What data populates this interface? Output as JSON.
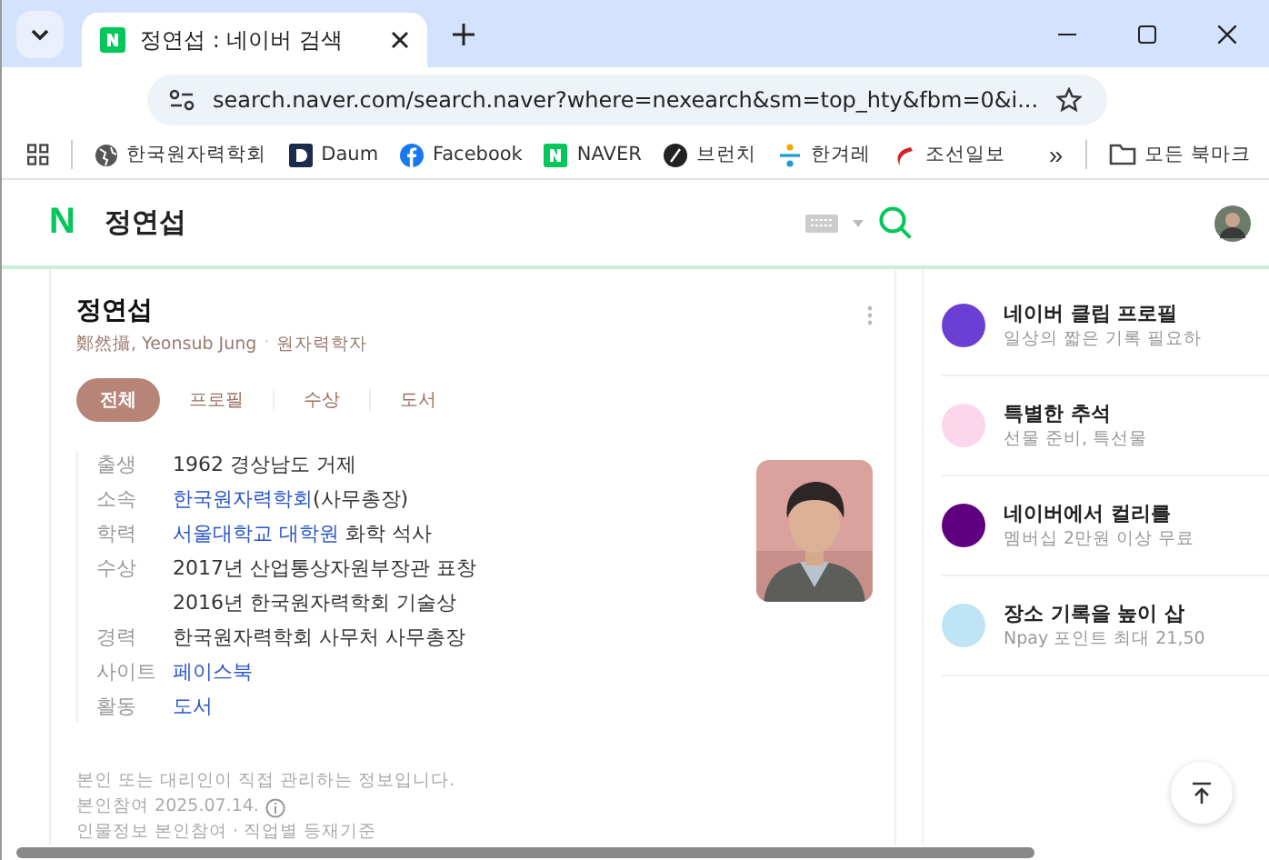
{
  "browser": {
    "tab": {
      "title": "정연섭 : 네이버 검색",
      "selected": true
    },
    "url": "search.naver.com/search.naver?where=nexearch&sm=top_hty&fbm=0&i...",
    "bookmarks": [
      {
        "label": "한국원자력학회",
        "kind": "globe"
      },
      {
        "label": "Daum",
        "kind": "daum"
      },
      {
        "label": "Facebook",
        "kind": "facebook"
      },
      {
        "label": "NAVER",
        "kind": "naver"
      },
      {
        "label": "브런치",
        "kind": "brunch"
      },
      {
        "label": "한겨레",
        "kind": "hani"
      },
      {
        "label": "조선일보",
        "kind": "chosun"
      }
    ],
    "overflow": "»",
    "all_bookmarks": "모든 북마크"
  },
  "header": {
    "logo": "N",
    "query": "정연섭"
  },
  "profile": {
    "name": "정연섭",
    "subtitle": "鄭然攝, Yeonsub Jung",
    "separator": "·",
    "job": "원자력학자",
    "tabs": [
      {
        "label": "전체",
        "selected": true
      },
      {
        "label": "프로필",
        "selected": false
      },
      {
        "label": "수상",
        "selected": false
      },
      {
        "label": "도서",
        "selected": false
      }
    ],
    "rows": [
      {
        "label": "출생",
        "parts": [
          {
            "text": "1962 경상남도 거제",
            "link": false
          }
        ]
      },
      {
        "label": "소속",
        "parts": [
          {
            "text": "한국원자력학회",
            "link": true
          },
          {
            "text": "(사무총장)",
            "link": false
          }
        ]
      },
      {
        "label": "학력",
        "parts": [
          {
            "text": "서울대학교 대학원",
            "link": true
          },
          {
            "text": " 화학 석사",
            "link": false
          }
        ]
      },
      {
        "label": "수상",
        "parts": [
          {
            "text": "2017년 산업통상자원부장관 표창",
            "link": false
          }
        ]
      },
      {
        "parts": [
          {
            "text": "2016년 한국원자력학회 기술상",
            "link": false
          }
        ]
      },
      {
        "label": "경력",
        "parts": [
          {
            "text": "한국원자력학회 사무처 사무총장",
            "link": false
          }
        ]
      },
      {
        "label": "사이트",
        "parts": [
          {
            "text": "페이스북",
            "link": true
          }
        ]
      },
      {
        "label": "활동",
        "parts": [
          {
            "text": "도서",
            "link": true
          }
        ]
      }
    ],
    "notice": "본인 또는 대리인이 직접 관리하는 정보입니다.",
    "date": "본인참여 2025.07.14.",
    "footer": "인물정보 본인참여 · 직업별 등재기준"
  },
  "side_items": [
    {
      "title": "네이버 클립 프로필",
      "subtitle": "일상의 짧은 기록 필요하",
      "color": "#6b3fd4"
    },
    {
      "title": "특별한 추석",
      "subtitle": "선물 준비, 특선물",
      "color": "#fcd6ea"
    },
    {
      "title": "네이버에서 컬리를",
      "subtitle": "멤버십 2만원 이상 무료",
      "color": "#5f0080"
    },
    {
      "title": "장소 기록을 높이 삽",
      "subtitle": "Npay 포인트 최대 21,50",
      "color": "#bfe4f5"
    }
  ]
}
